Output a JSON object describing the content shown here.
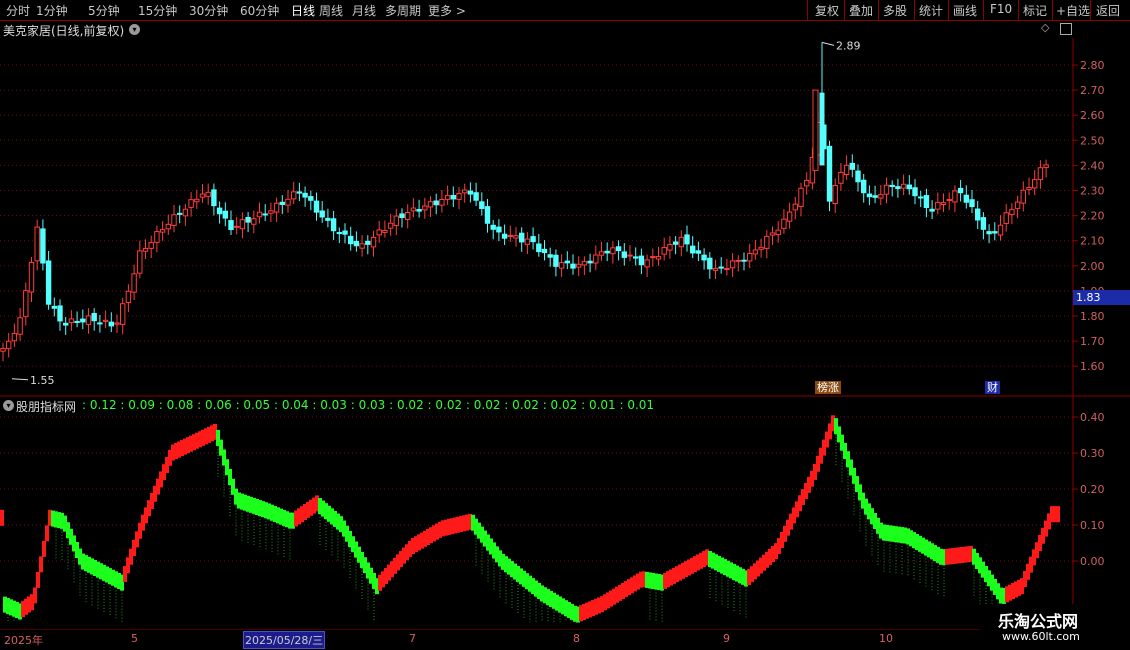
{
  "toolbar": {
    "periods": [
      "分时",
      "1分钟",
      "5分钟",
      "15分钟",
      "30分钟",
      "60分钟",
      "日线",
      "周线",
      "月线",
      "多周期",
      "更多"
    ],
    "active_period": "日线",
    "right": [
      "复权",
      "叠加",
      "多股",
      "统计",
      "画线",
      "F10",
      "标记",
      "+自选",
      "返回"
    ]
  },
  "main_chart": {
    "title": "美克家居(日线,前复权)",
    "price_labels": [
      "2.80",
      "2.70",
      "2.60",
      "2.50",
      "2.40",
      "2.30",
      "2.20",
      "2.10",
      "2.00",
      "1.90",
      "1.80",
      "1.70",
      "1.60"
    ],
    "current_price": "1.83",
    "high_marker": "2.89",
    "low_marker": "1.55",
    "badge_a": "榜",
    "badge_b": "涨",
    "badge_c": "财",
    "up_color": "#ff3c3c",
    "down_color": "#54ffff"
  },
  "indicator": {
    "name": "股朋指标网",
    "values": [
      "0.12",
      "0.09",
      "0.08",
      "0.06",
      "0.05",
      "0.04",
      "0.03",
      "0.03",
      "0.02",
      "0.02",
      "0.02",
      "0.02",
      "0.02",
      "0.01",
      "0.01"
    ],
    "axis_labels": [
      "0.40",
      "0.30",
      "0.20",
      "0.10",
      "0.00"
    ],
    "up_color": "#ff1a1a",
    "down_color": "#1cff1c"
  },
  "x_axis": {
    "labels": [
      "2025年",
      "5",
      "7",
      "8",
      "9",
      "10"
    ],
    "cursor_date": "2025/05/28/三"
  },
  "watermark": {
    "line1": "乐淘公式网",
    "line2": "www.60lt.com"
  }
}
